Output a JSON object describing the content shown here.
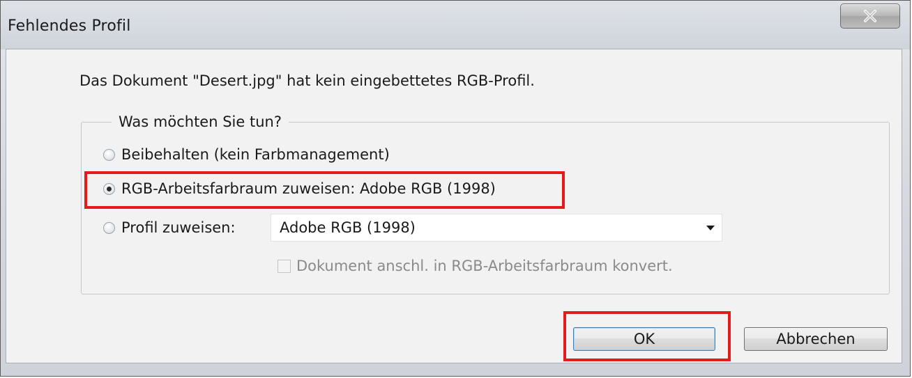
{
  "window": {
    "title": "Fehlendes Profil",
    "close_icon": "close-icon"
  },
  "message": "Das Dokument \"Desert.jpg\" hat kein eingebettetes RGB-Profil.",
  "group": {
    "title": "Was möchten Sie tun?",
    "options": [
      {
        "label": "Beibehalten (kein Farbmanagement)",
        "checked": false
      },
      {
        "label": "RGB-Arbeitsfarbraum zuweisen: Adobe RGB (1998)",
        "checked": true
      },
      {
        "label": "Profil zuweisen:",
        "checked": false
      }
    ],
    "profile_select": {
      "value": "Adobe RGB (1998)"
    },
    "convert_checkbox": {
      "label": "Dokument anschl. in RGB-Arbeitsfarbraum konvert.",
      "checked": false,
      "enabled": false
    }
  },
  "buttons": {
    "ok": "OK",
    "cancel": "Abbrechen"
  },
  "colors": {
    "highlight": "#e41b1b",
    "default_button_border": "#3c7fb1"
  }
}
